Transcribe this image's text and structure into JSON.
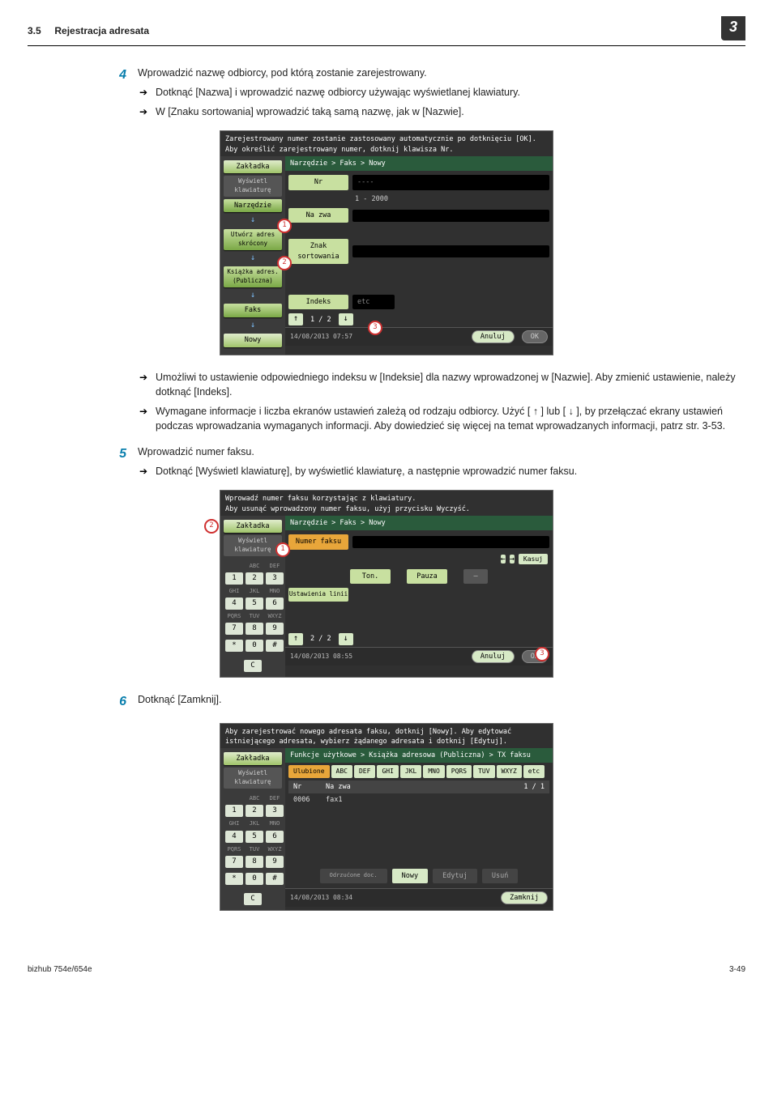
{
  "header": {
    "section_no": "3.5",
    "section_title": "Rejestracja adresata",
    "chapter": "3"
  },
  "steps": {
    "s4": {
      "num": "4",
      "text": "Wprowadzić nazwę odbiorcy, pod którą zostanie zarejestrowany.",
      "subs": [
        "Dotknąć [Nazwa] i wprowadzić nazwę odbiorcy używając wyświetlanej klawiatury.",
        "W [Znaku sortowania] wprowadzić taką samą nazwę, jak w [Nazwie]."
      ],
      "after": [
        "Umożliwi to ustawienie odpowiedniego indeksu w [Indeksie] dla nazwy wprowadzonej w [Nazwie]. Aby zmienić ustawienie, należy dotknąć [Indeks].",
        "Wymagane informacje i liczba ekranów ustawień zależą od rodzaju odbiorcy. Użyć [ ↑ ] lub [ ↓ ], by przełączać ekrany ustawień podczas wprowadzania wymaganych informacji. Aby dowiedzieć się więcej na temat wprowadzanych informacji, patrz str. 3-53."
      ]
    },
    "s5": {
      "num": "5",
      "text": "Wprowadzić numer faksu.",
      "subs": [
        "Dotknąć [Wyświetl klawiaturę], by wyświetlić klawiaturę, a następnie wprowadzić numer faksu."
      ]
    },
    "s6": {
      "num": "6",
      "text": "Dotknąć [Zamknij]."
    }
  },
  "screen1": {
    "hint": "Zarejestrowany numer zostanie zastosowany automatycznie po dotknięciu [OK].\nAby określić zarejestrowany numer, dotknij klawisza Nr.",
    "side": [
      "Zakładka",
      "Wyświetl klawiaturę",
      "Narzędzie",
      "Utwórz adres skrócony",
      "Książka adres. (Publiczna)",
      "Faks",
      "Nowy"
    ],
    "breadcrumb": "Narzędzie > Faks > Nowy",
    "fields": {
      "nr_label": "Nr",
      "nr_val": "----",
      "range": "1 - 2000",
      "nazwa_label": "Na zwa",
      "sort_label": "Znak sortowania",
      "index_label": "Indeks",
      "etc_label": "etc"
    },
    "pager": "1 / 2",
    "datetime": "14/08/2013    07:57",
    "cancel": "Anuluj",
    "ok": "OK",
    "marks": [
      "1",
      "2",
      "3"
    ]
  },
  "screen2": {
    "hint": "Wprowadź numer faksu korzystając z klawiatury.\nAby usunąć wprowadzony numer faksu, użyj przycisku Wyczyść.",
    "side_tab": "Zakładka",
    "side_disp": "Wyświetl klawiaturę",
    "keylabels": [
      "ABC",
      "DEF",
      "GHI",
      "JKL",
      "MNO",
      "PQRS",
      "TUV",
      "WXYZ"
    ],
    "keys": [
      "1",
      "2",
      "3",
      "4",
      "5",
      "6",
      "7",
      "8",
      "9",
      "*",
      "0",
      "#",
      "C"
    ],
    "breadcrumb": "Narzędzie > Faks > Nowy",
    "numer_label": "Numer faksu",
    "kasuj": "Kasuj",
    "ton": "Ton.",
    "pauza": "Pauza",
    "dash": "—",
    "ust": "Ustawienia linii",
    "pager": "2 / 2",
    "datetime": "14/08/2013    08:55",
    "cancel": "Anuluj",
    "ok": "OK",
    "marks": [
      "1",
      "2",
      "3"
    ]
  },
  "screen3": {
    "hint": "Aby zarejestrować nowego adresata faksu, dotknij [Nowy]. Aby edytować istniejącego adresata, wybierz żądanego adresata i dotknij [Edytuj].",
    "side_tab": "Zakładka",
    "side_disp": "Wyświetl klawiaturę",
    "keylabels": [
      "ABC",
      "DEF",
      "GHI",
      "JKL",
      "MNO",
      "PQRS",
      "TUV",
      "WXYZ"
    ],
    "keys": [
      "1",
      "2",
      "3",
      "4",
      "5",
      "6",
      "7",
      "8",
      "9",
      "*",
      "0",
      "#",
      "C"
    ],
    "breadcrumb": "Funkcje użytkowe > Książka adresowa (Publiczna) > TX faksu",
    "tabs": [
      "Ulubione",
      "ABC",
      "DEF",
      "GHI",
      "JKL",
      "MNO",
      "PQRS",
      "TUV",
      "WXYZ",
      "etc"
    ],
    "col_nr": "Nr",
    "col_name": "Na zwa",
    "row_nr": "0006",
    "row_name": "fax1",
    "page": "1 / 1",
    "cmds": [
      "Odrzućone doc.",
      "Nowy",
      "Edytuj",
      "Usuń"
    ],
    "datetime": "14/08/2013    08:34",
    "close": "Zamknij"
  },
  "footer": {
    "model": "bizhub 754e/654e",
    "page": "3-49"
  }
}
